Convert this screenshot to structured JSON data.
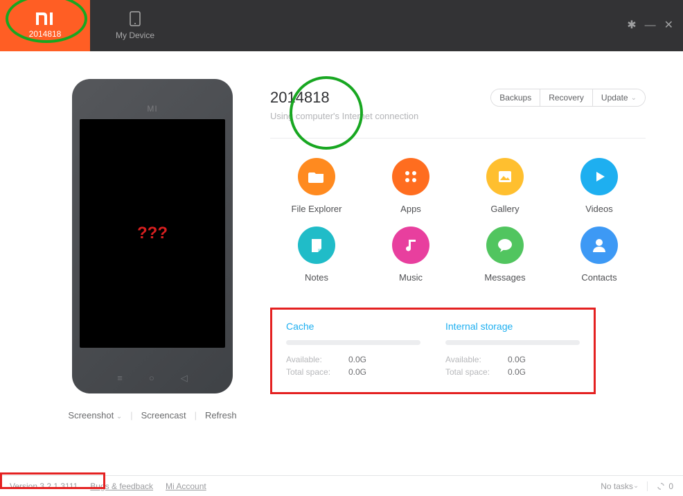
{
  "titlebar": {
    "tabs": [
      {
        "label": "2014818",
        "icon": "mi-logo"
      },
      {
        "label": "My Device",
        "icon": "phone"
      }
    ]
  },
  "phone": {
    "brand": "MI",
    "screen_text": "???",
    "actions": {
      "screenshot": "Screenshot",
      "screencast": "Screencast",
      "refresh": "Refresh"
    }
  },
  "device": {
    "name": "2014818",
    "subtitle": "Using computer's Internet connection",
    "buttons": {
      "backups": "Backups",
      "recovery": "Recovery",
      "update": "Update"
    }
  },
  "tiles": [
    {
      "label": "File Explorer",
      "icon": "folder",
      "color": "c-orange"
    },
    {
      "label": "Apps",
      "icon": "apps",
      "color": "c-orange2"
    },
    {
      "label": "Gallery",
      "icon": "gallery",
      "color": "c-yellow"
    },
    {
      "label": "Videos",
      "icon": "video",
      "color": "c-blue"
    },
    {
      "label": "Notes",
      "icon": "note",
      "color": "c-cyan"
    },
    {
      "label": "Music",
      "icon": "music",
      "color": "c-pink"
    },
    {
      "label": "Messages",
      "icon": "message",
      "color": "c-green"
    },
    {
      "label": "Contacts",
      "icon": "contact",
      "color": "c-blue2"
    }
  ],
  "storage": {
    "cache": {
      "title": "Cache",
      "available_label": "Available:",
      "available": "0.0G",
      "total_label": "Total space:",
      "total": "0.0G"
    },
    "internal": {
      "title": "Internal storage",
      "available_label": "Available:",
      "available": "0.0G",
      "total_label": "Total space:",
      "total": "0.0G"
    }
  },
  "statusbar": {
    "version": "Version 3.2.1.3111",
    "bugs": "Bugs & feedback",
    "account": "Mi Account",
    "tasks": "No tasks",
    "sync_count": "0"
  }
}
